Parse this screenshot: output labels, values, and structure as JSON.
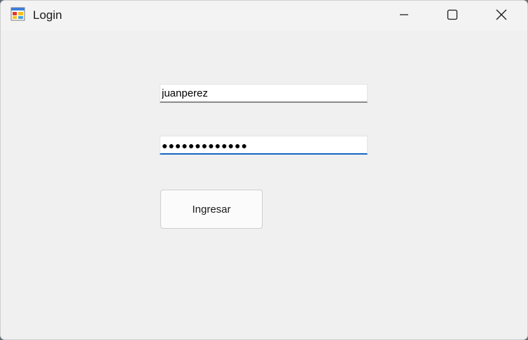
{
  "window": {
    "title": "Login",
    "icon": "app-form-icon",
    "controls": {
      "minimize": "minimize-icon",
      "maximize": "maximize-icon",
      "close": "close-icon"
    }
  },
  "form": {
    "username": {
      "value": "juanperez"
    },
    "password": {
      "masked_value": "●●●●●●●●●●●●●"
    },
    "submit_label": "Ingresar"
  },
  "colors": {
    "focus_accent": "#1565c0",
    "window_background": "#f0f0f0"
  }
}
